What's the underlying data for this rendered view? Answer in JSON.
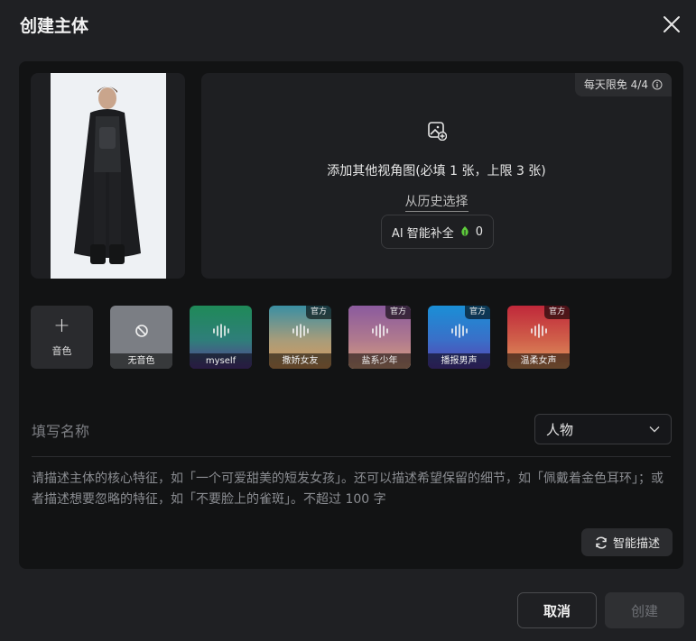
{
  "dialog": {
    "title": "创建主体",
    "close_icon": "close-icon"
  },
  "upload": {
    "quota_label": "每天限免 4/4",
    "hint": "添加其他视角图(必填 1 张，上限 3 张)",
    "history_link": "从历史选择",
    "ai_complete_label": "AI 智能补全",
    "ai_credit": "0",
    "credit_color": "#5ecb3c"
  },
  "voices": {
    "add_label": "音色",
    "items": [
      {
        "label": "无音色",
        "official": false,
        "icon": "no-voice-icon"
      },
      {
        "label": "myself",
        "official": false,
        "icon": "waveform-icon"
      },
      {
        "label": "撒娇女友",
        "official": true,
        "icon": "waveform-icon"
      },
      {
        "label": "盐系少年",
        "official": true,
        "icon": "waveform-icon",
        "selected": true
      },
      {
        "label": "播报男声",
        "official": true,
        "icon": "waveform-icon"
      },
      {
        "label": "温柔女声",
        "official": true,
        "icon": "waveform-icon"
      }
    ],
    "official_tag": "官方"
  },
  "form": {
    "name_placeholder": "填写名称",
    "type_value": "人物",
    "description_placeholder": "请描述主体的核心特征，如「一个可爱甜美的短发女孩」。还可以描述希望保留的细节，如「佩戴着金色耳环」；或者描述想要忽略的特征，如「不要脸上的雀斑」。不超过 100 字",
    "smart_describe_label": "智能描述"
  },
  "footer": {
    "cancel_label": "取消",
    "create_label": "创建"
  }
}
